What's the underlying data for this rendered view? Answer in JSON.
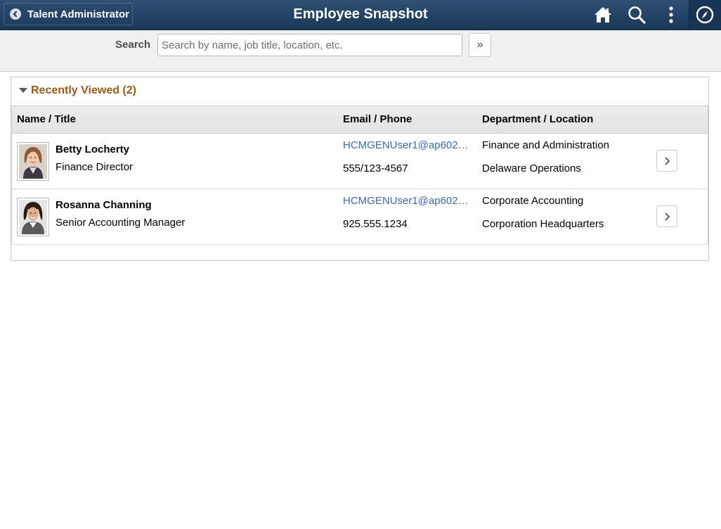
{
  "header": {
    "back_label": "Talent Administrator",
    "title": "Employee Snapshot",
    "icons": [
      "home-icon",
      "search-icon",
      "actions-menu-icon",
      "navbar-compass-icon"
    ]
  },
  "search": {
    "label": "Search",
    "placeholder": "Search by name, job title, location, etc.",
    "go_label": "»"
  },
  "recent": {
    "title": "Recently Viewed (2)",
    "columns": {
      "name": "Name / Title",
      "email": "Email / Phone",
      "dept": "Department / Location"
    },
    "rows": [
      {
        "name": "Betty Locherty",
        "title": "Finance Director",
        "email": "HCMGENUser1@ap6023f…",
        "phone": "555/123-4567",
        "department": "Finance and Administration",
        "location": "Delaware Operations"
      },
      {
        "name": "Rosanna Channing",
        "title": "Senior Accounting Manager",
        "email": "HCMGENUser1@ap6023f…",
        "phone": "925.555.1234",
        "department": "Corporate Accounting",
        "location": "Corporation Headquarters"
      }
    ]
  },
  "colors": {
    "header_bg": "#234466",
    "group_title": "#9c5a15",
    "link": "#3b68b4"
  }
}
